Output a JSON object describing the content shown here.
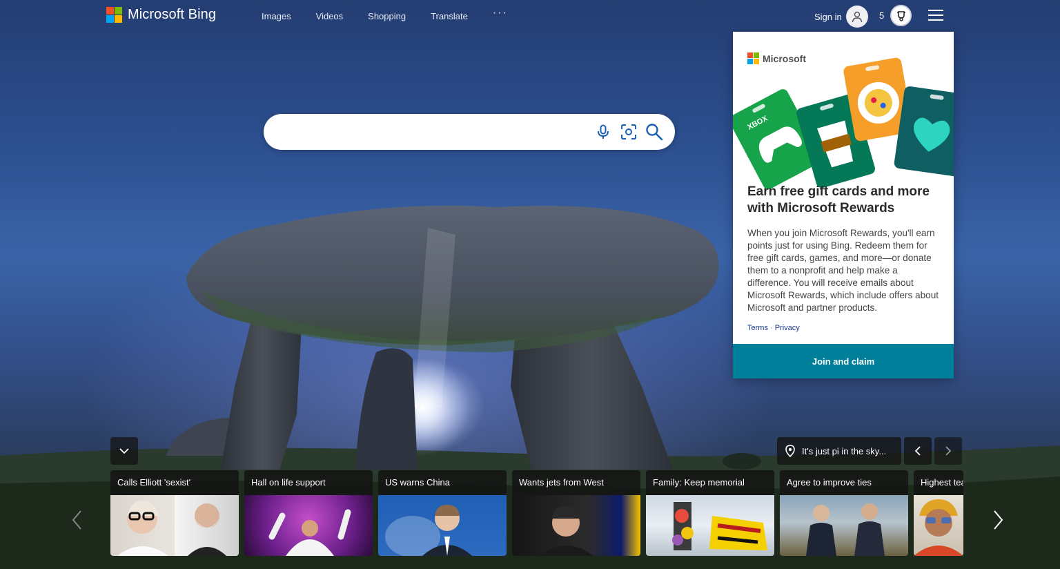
{
  "brand": {
    "name": "Microsoft Bing",
    "colors": {
      "red": "#f25022",
      "green": "#7fba00",
      "blue": "#00a4ef",
      "yellow": "#ffb900"
    }
  },
  "nav": {
    "items": [
      {
        "label": "Images"
      },
      {
        "label": "Videos"
      },
      {
        "label": "Shopping"
      },
      {
        "label": "Translate"
      }
    ],
    "more_label": "···"
  },
  "account": {
    "signin_label": "Sign in",
    "rewards_points": "5"
  },
  "search": {
    "placeholder": "",
    "value": "",
    "icons": [
      "microphone-icon",
      "visual-search-icon",
      "search-icon"
    ]
  },
  "rewards_card": {
    "logo_text": "Microsoft",
    "gift_cards": [
      "XBOX"
    ],
    "title": "Earn free gift cards and more with Microsoft Rewards",
    "body": "When you join Microsoft Rewards, you'll earn points just for using Bing. Redeem them for free gift cards, games, and more—or donate them to a nonprofit and help make a difference. You will receive emails about Microsoft Rewards, which include offers about Microsoft and partner products.",
    "links": {
      "terms": "Terms",
      "separator": " · ",
      "privacy": "Privacy"
    },
    "button_label": "Join and claim",
    "accent": "#007f9a"
  },
  "image_info": {
    "location_label": "It's just pi in the sky..."
  },
  "news": [
    {
      "title": "Calls Elliott 'sexist'"
    },
    {
      "title": "Hall on life support"
    },
    {
      "title": "US warns China"
    },
    {
      "title": "Wants jets from West"
    },
    {
      "title": "Family: Keep memorial"
    },
    {
      "title": "Agree to improve ties"
    },
    {
      "title": "Highest tea"
    }
  ]
}
